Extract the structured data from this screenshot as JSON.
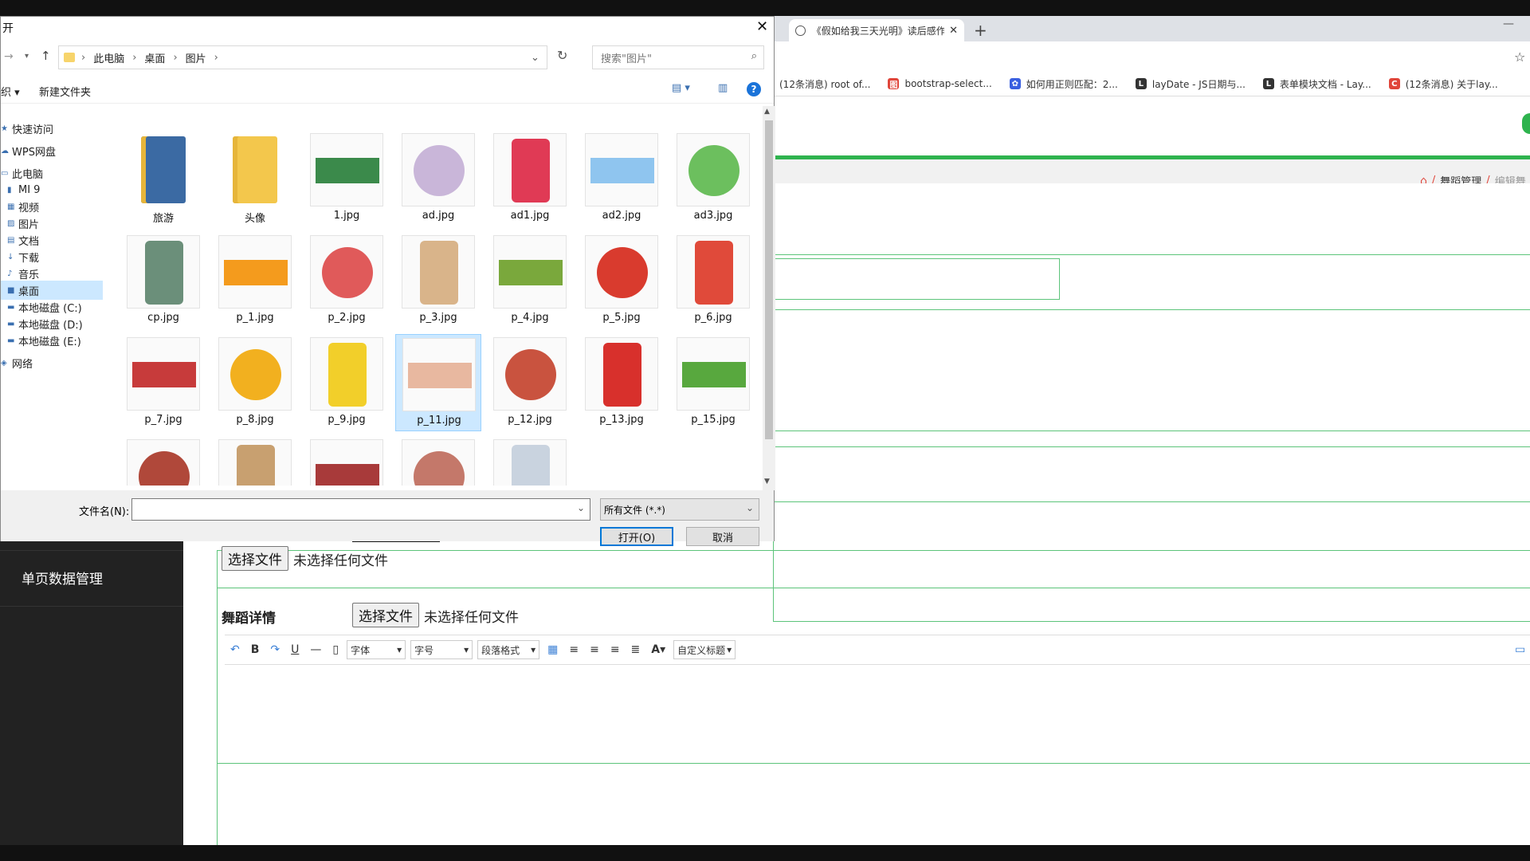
{
  "dialog": {
    "title": "开",
    "close_symbol": "✕",
    "breadcrumb": [
      "此电脑",
      "桌面",
      "图片"
    ],
    "search_placeholder": "搜索\"图片\"",
    "toolbar": {
      "organize_label": "织 ▾",
      "new_folder_label": "新建文件夹"
    },
    "nav_items": [
      {
        "label": "快速访问"
      },
      {
        "label": "WPS网盘"
      },
      {
        "label": "此电脑"
      },
      {
        "label": "MI 9"
      },
      {
        "label": "视频"
      },
      {
        "label": "图片"
      },
      {
        "label": "文档"
      },
      {
        "label": "下载"
      },
      {
        "label": "音乐"
      },
      {
        "label": "桌面",
        "selected": true
      },
      {
        "label": "本地磁盘 (C:)"
      },
      {
        "label": "本地磁盘 (D:)"
      },
      {
        "label": "本地磁盘 (E:)"
      },
      {
        "label": "网络"
      }
    ],
    "files": [
      {
        "name": "旅游",
        "kind": "folder"
      },
      {
        "name": "头像",
        "kind": "folder"
      },
      {
        "name": "1.jpg",
        "kind": "image"
      },
      {
        "name": "ad.jpg",
        "kind": "image"
      },
      {
        "name": "ad1.jpg",
        "kind": "image"
      },
      {
        "name": "ad2.jpg",
        "kind": "image"
      },
      {
        "name": "ad3.jpg",
        "kind": "image"
      },
      {
        "name": "cp.jpg",
        "kind": "image"
      },
      {
        "name": "p_1.jpg",
        "kind": "image"
      },
      {
        "name": "p_2.jpg",
        "kind": "image"
      },
      {
        "name": "p_3.jpg",
        "kind": "image"
      },
      {
        "name": "p_4.jpg",
        "kind": "image"
      },
      {
        "name": "p_5.jpg",
        "kind": "image"
      },
      {
        "name": "p_6.jpg",
        "kind": "image"
      },
      {
        "name": "p_7.jpg",
        "kind": "image"
      },
      {
        "name": "p_8.jpg",
        "kind": "image"
      },
      {
        "name": "p_9.jpg",
        "kind": "image"
      },
      {
        "name": "p_11.jpg",
        "kind": "image",
        "selected": true
      },
      {
        "name": "p_12.jpg",
        "kind": "image"
      },
      {
        "name": "p_13.jpg",
        "kind": "image"
      },
      {
        "name": "p_15.jpg",
        "kind": "image"
      }
    ],
    "filename_label": "文件名(N):",
    "filename_value": "",
    "filetype_value": "所有文件 (*.*)",
    "open_label": "打开(O)",
    "cancel_label": "取消"
  },
  "browser": {
    "tabs": [
      {
        "title": "《假如给我三天光明》读后感作文"
      }
    ],
    "new_tab_symbol": "+",
    "bookmarks": [
      {
        "label": "(12条消息) root of...",
        "color": "#fff"
      },
      {
        "label": "bootstrap-select...",
        "color": "#e0453a"
      },
      {
        "label": "如何用正则匹配：2...",
        "color": "#3a5fe0"
      },
      {
        "label": "layDate - JS日期与...",
        "color": "#333"
      },
      {
        "label": "表单模块文档 - Lay...",
        "color": "#333"
      },
      {
        "label": "(12条消息) 关于lay...",
        "color": "#e0453a"
      }
    ],
    "breadcrumb": [
      "舞蹈管理",
      "编辑舞"
    ],
    "sidebar_item": "单页数据管理",
    "choose_file_label": "选择文件",
    "no_file_label": "未选择任何文件",
    "dance_detail_label": "舞蹈详情",
    "editor_selects": [
      "字体",
      "字号",
      "段落格式",
      "自定义标题"
    ],
    "accent_color": "#2eb34e"
  }
}
